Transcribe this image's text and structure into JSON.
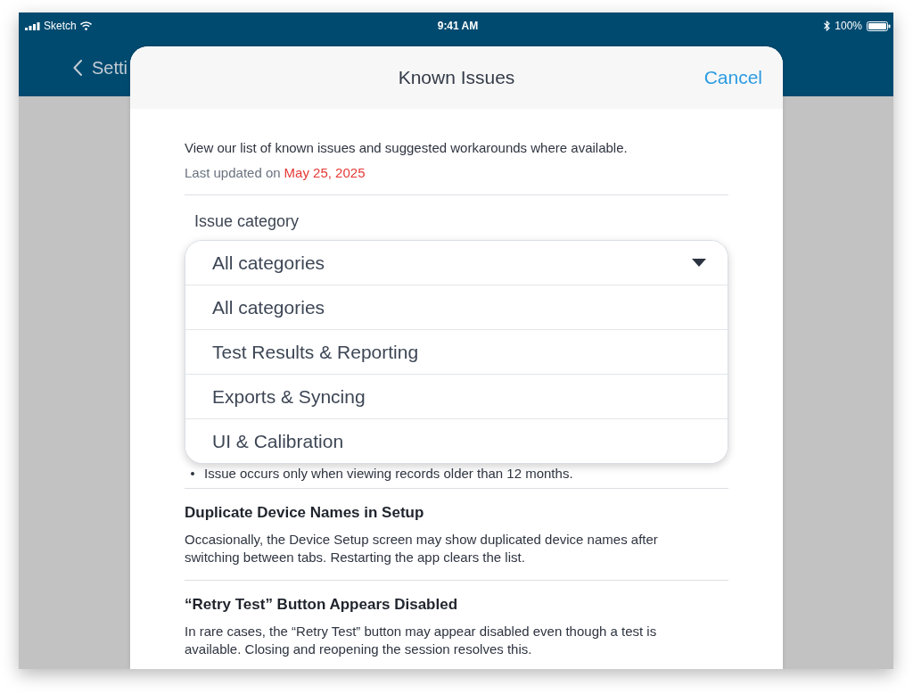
{
  "status_bar": {
    "carrier": "Sketch",
    "time": "9:41 AM",
    "battery": "100%"
  },
  "nav_bar": {
    "back_label": "Setti"
  },
  "modal": {
    "title": "Known Issues",
    "cancel_button": "Cancel",
    "intro": "View our list of known issues and suggested workarounds where available.",
    "updated": {
      "label": "Last updated on",
      "date": "May 25, 2025"
    },
    "filter": {
      "label": "Issue category",
      "value": "All categories",
      "expanded": true,
      "options": [
        "All categories",
        "Test Results & Reporting",
        "Exports & Syncing",
        "UI & Calibration"
      ]
    },
    "issues": [
      {
        "kind": "bullet",
        "text": "Issue occurs only when viewing records older than 12 months."
      },
      {
        "kind": "entry",
        "title": "Duplicate Device Names in Setup",
        "description": "Occasionally, the Device Setup screen may show duplicated device names after switching between tabs. Restarting the app clears the list."
      },
      {
        "kind": "entry",
        "title": "“Retry Test” Button Appears Disabled",
        "description": "In rare cases, the “Retry Test” button may appear disabled even though a test is available. Closing and reopening the session resolves this."
      }
    ]
  }
}
